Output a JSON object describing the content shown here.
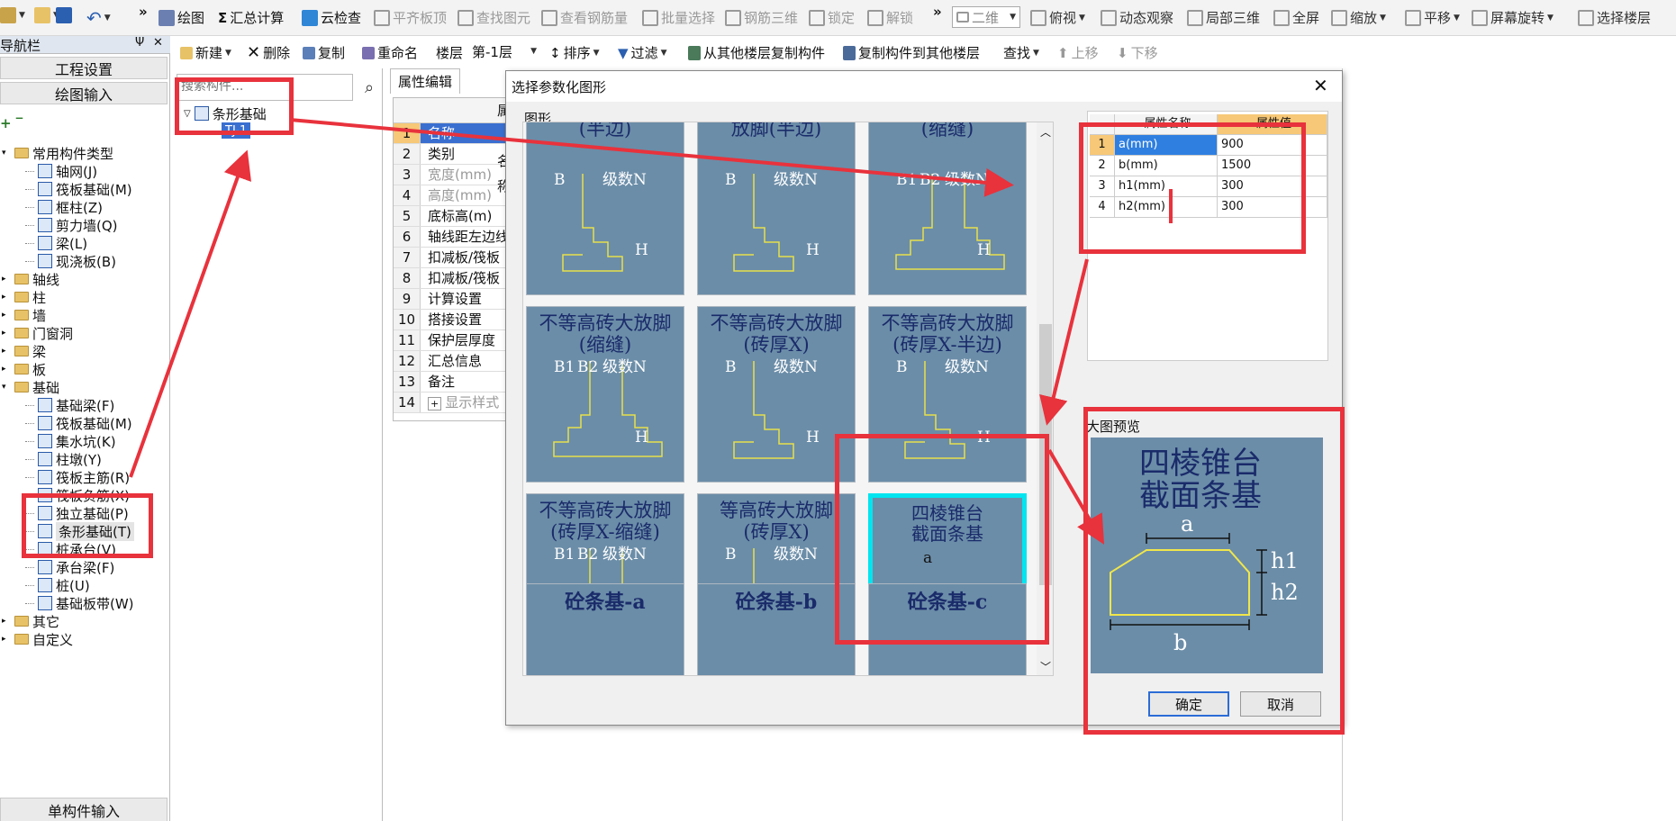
{
  "toolbar1": {
    "draw": "绘图",
    "sum_calc": "汇总计算",
    "cloud_check": "云检查",
    "align_top": "平齐板顶",
    "find_element": "查找图元",
    "view_rebar": "查看钢筋量",
    "batch_select": "批量选择",
    "rebar_3d": "钢筋三维",
    "lock": "锁定",
    "unlock": "解锁",
    "view_mode": "二维",
    "top_view": "俯视",
    "dynamic_view": "动态观察",
    "local_3d": "局部三维",
    "fullscreen": "全屏",
    "zoom": "缩放",
    "pan": "平移",
    "rotate": "屏幕旋转",
    "select_floor": "选择楼层"
  },
  "toolbar2": {
    "new": "新建",
    "delete": "删除",
    "copy": "复制",
    "rename": "重命名",
    "floor_label": "楼层",
    "floor_value": "第-1层",
    "sort": "排序",
    "filter": "过滤",
    "copy_from": "从其他楼层复制构件",
    "copy_to": "复制构件到其他楼层",
    "find": "查找",
    "move_up": "上移",
    "move_down": "下移"
  },
  "nav": {
    "title": "模块导航栏",
    "pin": "Ψ",
    "close": "✕",
    "project_settings": "工程设置",
    "draw_input": "绘图输入",
    "single_input": "单构件输入",
    "tree": [
      {
        "label": "常用构件类型",
        "type": "folder",
        "open": true
      },
      {
        "label": "轴网(J)",
        "type": "item"
      },
      {
        "label": "筏板基础(M)",
        "type": "item"
      },
      {
        "label": "框柱(Z)",
        "type": "item"
      },
      {
        "label": "剪力墙(Q)",
        "type": "item"
      },
      {
        "label": "梁(L)",
        "type": "item"
      },
      {
        "label": "现浇板(B)",
        "type": "item"
      },
      {
        "label": "轴线",
        "type": "folder"
      },
      {
        "label": "柱",
        "type": "folder"
      },
      {
        "label": "墙",
        "type": "folder"
      },
      {
        "label": "门窗洞",
        "type": "folder"
      },
      {
        "label": "梁",
        "type": "folder"
      },
      {
        "label": "板",
        "type": "folder"
      },
      {
        "label": "基础",
        "type": "folder",
        "open": true
      },
      {
        "label": "基础梁(F)",
        "type": "item"
      },
      {
        "label": "筏板基础(M)",
        "type": "item"
      },
      {
        "label": "集水坑(K)",
        "type": "item"
      },
      {
        "label": "柱墩(Y)",
        "type": "item"
      },
      {
        "label": "筏板主筋(R)",
        "type": "item"
      },
      {
        "label": "筏板负筋(X)",
        "type": "item"
      },
      {
        "label": "独立基础(P)",
        "type": "item"
      },
      {
        "label": "条形基础(T)",
        "type": "item",
        "selected": true
      },
      {
        "label": "桩承台(V)",
        "type": "item"
      },
      {
        "label": "承台梁(F)",
        "type": "item"
      },
      {
        "label": "桩(U)",
        "type": "item"
      },
      {
        "label": "基础板带(W)",
        "type": "item"
      },
      {
        "label": "其它",
        "type": "folder"
      },
      {
        "label": "自定义",
        "type": "folder"
      }
    ]
  },
  "component_panel": {
    "search_placeholder": "搜索构件...",
    "root": "条形基础",
    "child": "TJ-1"
  },
  "properties": {
    "tab": "属性编辑",
    "col_name": "属性名称",
    "rows": [
      {
        "n": "1",
        "name": "名称"
      },
      {
        "n": "2",
        "name": "类别"
      },
      {
        "n": "3",
        "name": "宽度(mm)",
        "muted": true
      },
      {
        "n": "4",
        "name": "高度(mm)",
        "muted": true
      },
      {
        "n": "5",
        "name": "底标高(m)"
      },
      {
        "n": "6",
        "name": "轴线距左边线"
      },
      {
        "n": "7",
        "name": "扣减板/筏板"
      },
      {
        "n": "8",
        "name": "扣减板/筏板"
      },
      {
        "n": "9",
        "name": "计算设置"
      },
      {
        "n": "10",
        "name": "搭接设置"
      },
      {
        "n": "11",
        "name": "保护层厚度"
      },
      {
        "n": "12",
        "name": "汇总信息"
      },
      {
        "n": "13",
        "name": "备注"
      },
      {
        "n": "14",
        "name": "显示样式",
        "muted": true,
        "expand": "+"
      }
    ]
  },
  "dialog": {
    "title": "选择参数化图形",
    "close": "✕",
    "group_label": "图形",
    "shapes": [
      {
        "title": "(半边)",
        "labels": [
          "B",
          "级数N",
          "H"
        ]
      },
      {
        "title": "放脚(半边)",
        "labels": [
          "B",
          "级数N",
          "H"
        ]
      },
      {
        "title": "(缩缝)",
        "labels": [
          "B1",
          "B2",
          "级数N",
          "H"
        ]
      },
      {
        "title": "不等高砖大放脚\n(缩缝)",
        "labels": [
          "B1",
          "B2",
          "级数N",
          "H"
        ]
      },
      {
        "title": "不等高砖大放脚\n(砖厚X)",
        "labels": [
          "B",
          "级数N",
          "H"
        ]
      },
      {
        "title": "不等高砖大放脚\n(砖厚X-半边)",
        "labels": [
          "B",
          "级数N",
          "H"
        ]
      },
      {
        "title": "不等高砖大放脚\n(砖厚X-缩缝)",
        "labels": [
          "B1",
          "B2",
          "级数N",
          "H"
        ]
      },
      {
        "title": "等高砖大放脚\n(砖厚X)",
        "labels": [
          "B",
          "级数N",
          "H"
        ]
      },
      {
        "title": "四棱锥台\n截面条基",
        "labels": [
          "a",
          "h1",
          "h2",
          "b"
        ],
        "selected": true
      },
      {
        "title": "砼条基-a"
      },
      {
        "title": "砼条基-b"
      },
      {
        "title": "砼条基-c"
      }
    ],
    "param_grid": {
      "col_name": "属性名称",
      "col_value": "属性值",
      "rows": [
        {
          "n": "1",
          "name": "a(mm)",
          "value": "900"
        },
        {
          "n": "2",
          "name": "b(mm)",
          "value": "1500"
        },
        {
          "n": "3",
          "name": "h1(mm)",
          "value": "300"
        },
        {
          "n": "4",
          "name": "h2(mm)",
          "value": "300"
        }
      ]
    },
    "preview_label": "大图预览",
    "preview_title": "四棱锥台\n截面条基",
    "preview_labels": {
      "a": "a",
      "b": "b",
      "h1": "h1",
      "h2": "h2"
    },
    "ok": "确定",
    "cancel": "取消"
  },
  "colors": {
    "annotation_red": "#e8323c",
    "thumb_bg": "#6b8da8",
    "selected_border": "#00e5f0",
    "param_header": "#f7c877"
  }
}
